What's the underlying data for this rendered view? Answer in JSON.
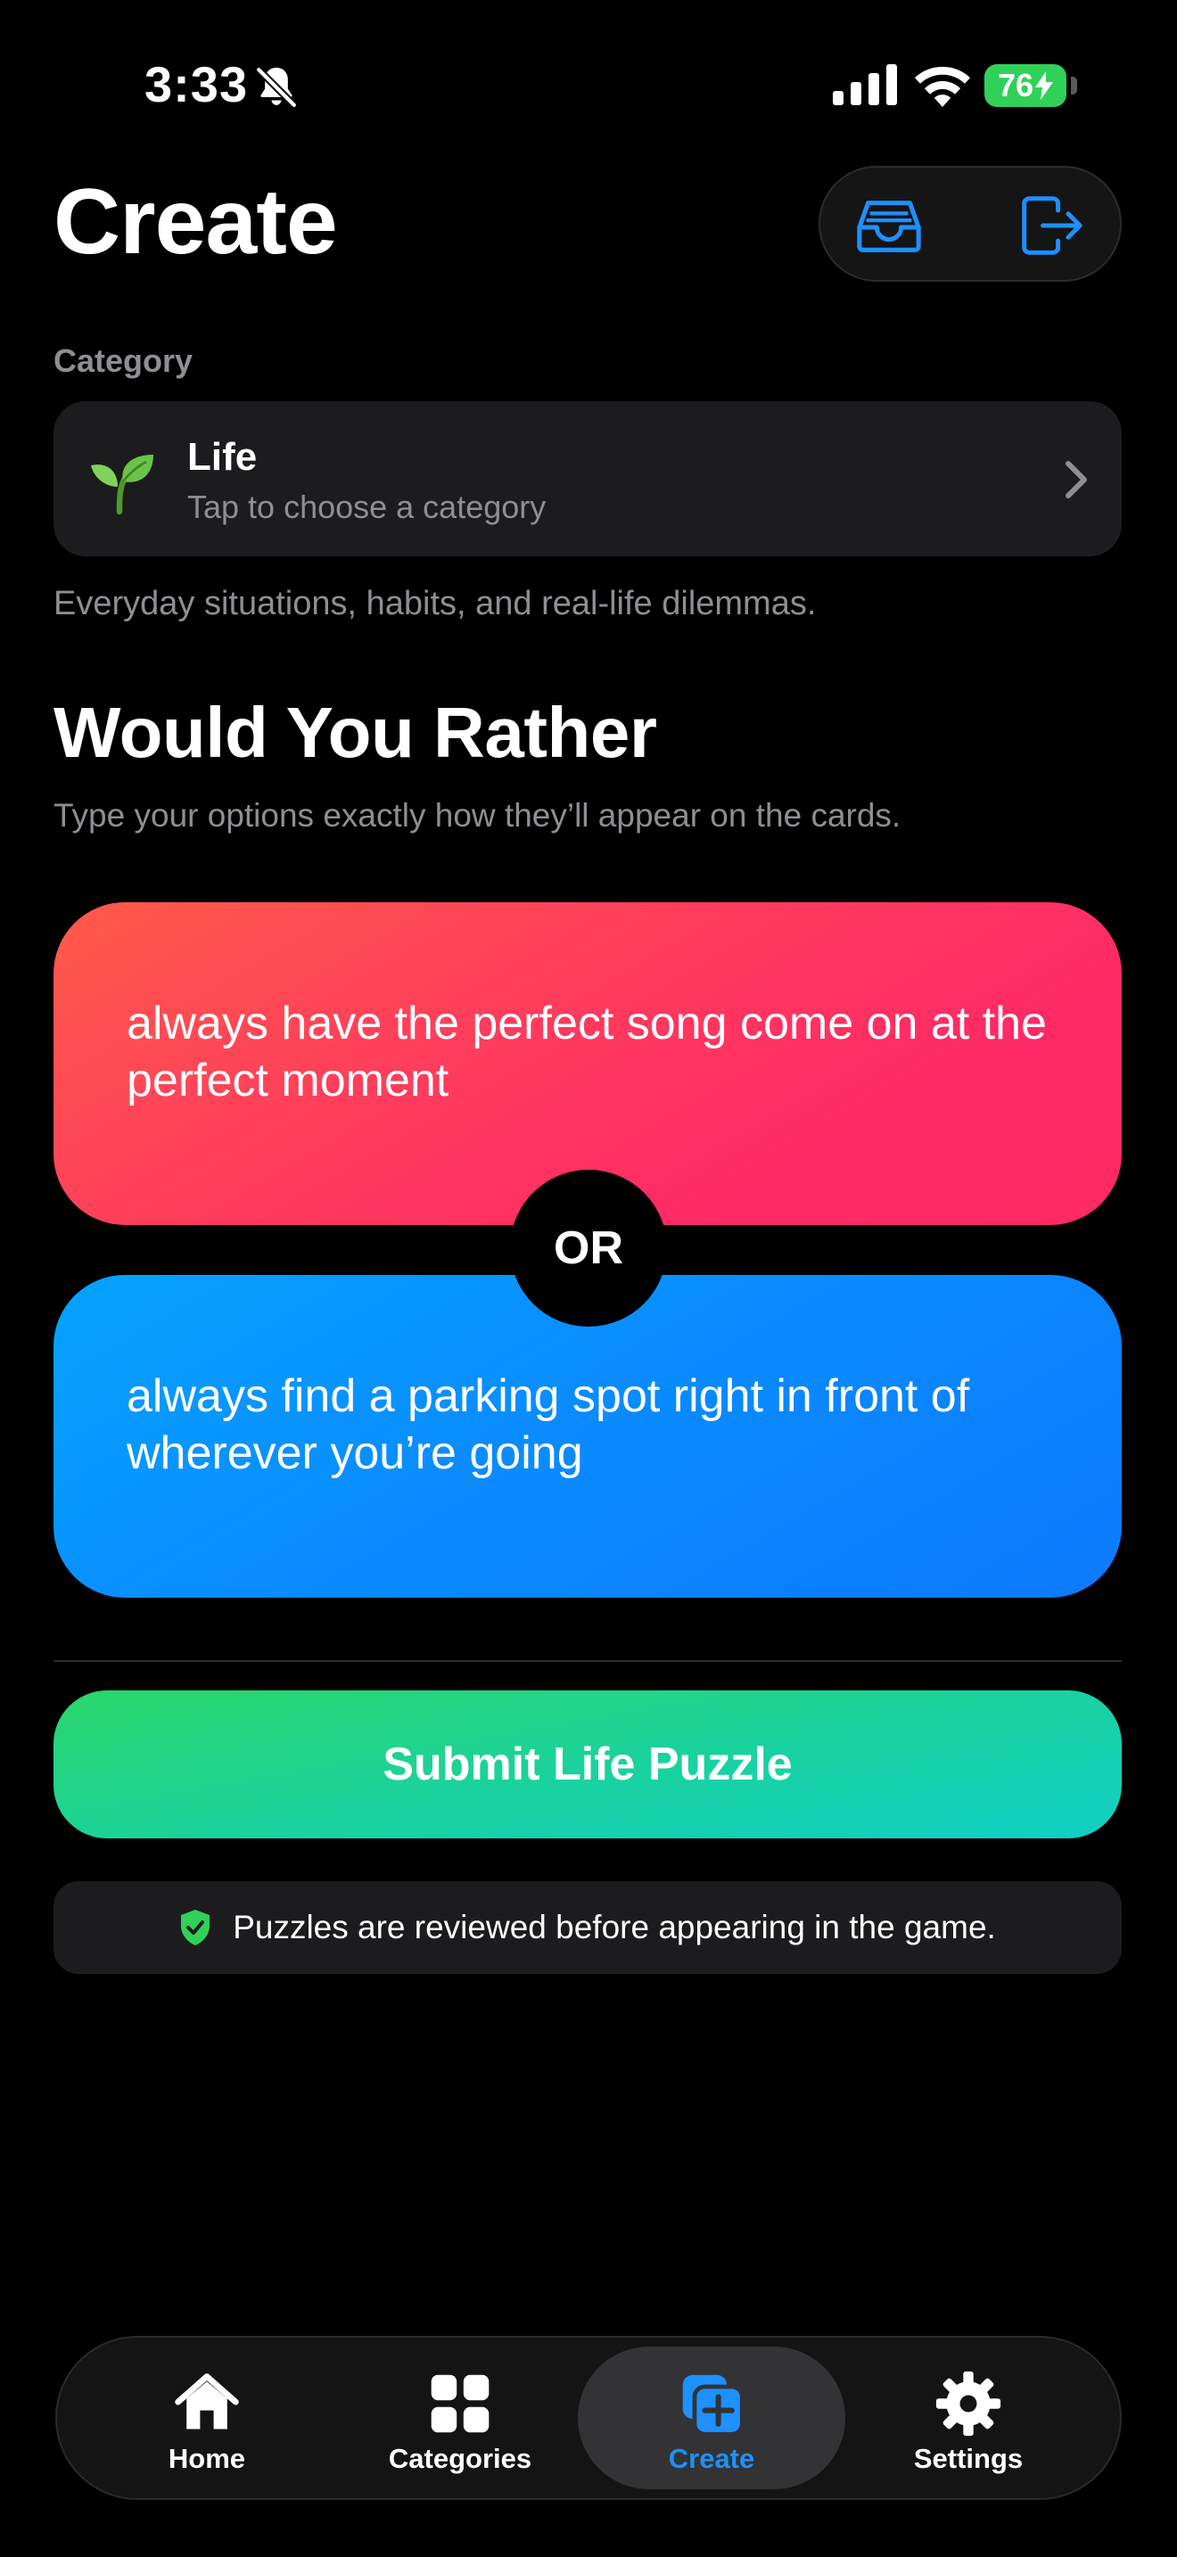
{
  "status_bar": {
    "time": "3:33",
    "battery": "76",
    "icons": [
      "bell-slash-icon",
      "cellular-signal-icon",
      "wifi-icon",
      "battery-charging-icon"
    ]
  },
  "header": {
    "title": "Create",
    "actions": [
      {
        "name": "inbox",
        "icon": "inbox-tray-icon"
      },
      {
        "name": "sign-out",
        "icon": "sign-out-icon"
      }
    ],
    "accent_color": "#1e90ff"
  },
  "category": {
    "label": "Category",
    "name": "Life",
    "hint": "Tap to choose a category",
    "icon": "seedling-icon",
    "description": "Everyday situations, habits, and real-life dilemmas."
  },
  "section": {
    "title": "Would You Rather",
    "subtitle": "Type your options exactly how they’ll appear on the cards."
  },
  "options": {
    "option_a": "always have the perfect song come on at the perfect moment",
    "separator": "OR",
    "option_b": "always find a parking spot right in front of wherever you’re going",
    "colors": {
      "option_a": "#ff3060",
      "option_b": "#0a84ff"
    }
  },
  "submit": {
    "label": "Submit Life Puzzle",
    "color": "#1dd39a"
  },
  "review_note": {
    "icon": "shield-check-icon",
    "text": "Puzzles are reviewed before appearing in the game."
  },
  "tab_bar": {
    "active": "Create",
    "items": [
      {
        "label": "Home",
        "icon": "house-icon"
      },
      {
        "label": "Categories",
        "icon": "grid-icon"
      },
      {
        "label": "Create",
        "icon": "plus-square-on-square-icon"
      },
      {
        "label": "Settings",
        "icon": "gear-icon"
      }
    ]
  }
}
